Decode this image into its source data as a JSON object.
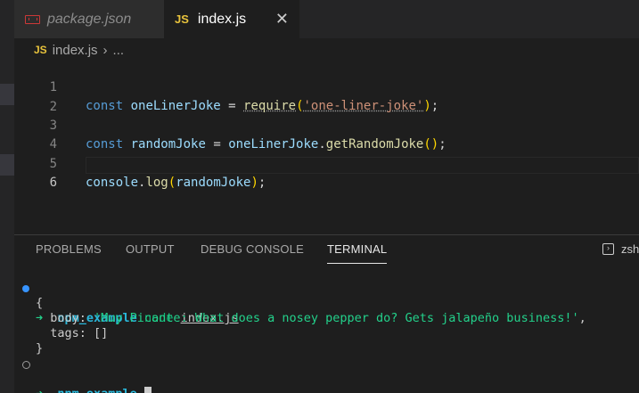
{
  "tabs": [
    {
      "label": "package.json",
      "icon": "npm-icon",
      "active": false
    },
    {
      "label": "index.js",
      "icon": "js-file-icon",
      "active": true,
      "close": "✕"
    }
  ],
  "breadcrumb": {
    "icon": "JS",
    "file": "index.js",
    "sep": "›",
    "rest": "..."
  },
  "editor": {
    "line_numbers": [
      "1",
      "2",
      "3",
      "4",
      "5",
      "6"
    ],
    "line1": {
      "kw": "const",
      "var": "oneLinerJoke",
      "eq": " = ",
      "fn": "require",
      "open": "(",
      "str": "'one-liner-joke'",
      "close": ")",
      "semi": ";"
    },
    "line3": {
      "kw": "const",
      "var": "randomJoke",
      "eq": " = ",
      "obj": "oneLinerJoke",
      "dot": ".",
      "fn": "getRandomJoke",
      "parens": "()",
      "semi": ";"
    },
    "line5": {
      "obj": "console",
      "dot": ".",
      "fn": "log",
      "open": "(",
      "arg": "randomJoke",
      "close": ")",
      "semi": ";"
    }
  },
  "panel": {
    "tabs": [
      "PROBLEMS",
      "OUTPUT",
      "DEBUG CONSOLE",
      "TERMINAL"
    ],
    "active_tab": "TERMINAL",
    "shell": "zsh"
  },
  "terminal": {
    "arrow": "➜",
    "dir": "npm_example",
    "cmd": "node",
    "arg": "index.js",
    "open_brace": "{",
    "body_key": "  body: ",
    "body_value": "'Muy Picante: What does a nosey pepper do? Gets jalapeño business!'",
    "body_comma": ",",
    "tags_line": "  tags: []",
    "close_brace": "}"
  },
  "colors": {
    "accent_blue": "#3794ff",
    "js_yellow": "#e8c33c",
    "npm_red": "#cb3837",
    "terminal_green": "#23d18b"
  }
}
